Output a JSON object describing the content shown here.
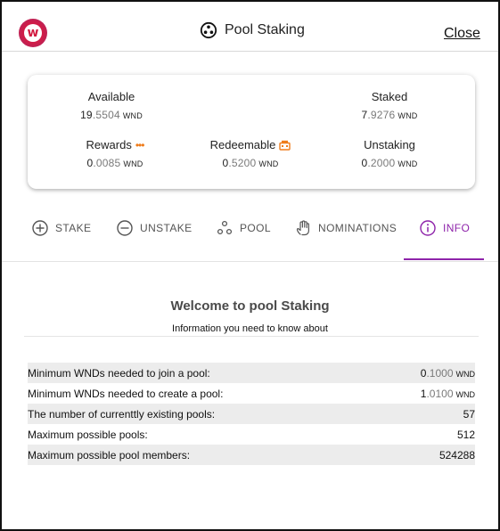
{
  "header": {
    "logo_letter": "w",
    "title": "Pool Staking",
    "close_label": "Close"
  },
  "balances": {
    "available": {
      "label": "Available",
      "int": "19",
      "dec": ".5504",
      "unit": "WND"
    },
    "staked": {
      "label": "Staked",
      "int": "7",
      "dec": ".9276",
      "unit": "WND"
    },
    "rewards": {
      "label": "Rewards",
      "int": "0",
      "dec": ".0085",
      "unit": "WND"
    },
    "redeemable": {
      "label": "Redeemable",
      "int": "0",
      "dec": ".5200",
      "unit": "WND"
    },
    "unstaking": {
      "label": "Unstaking",
      "int": "0",
      "dec": ".2000",
      "unit": "WND"
    }
  },
  "tabs": [
    {
      "label": "STAKE",
      "icon": "plus-circle-icon"
    },
    {
      "label": "UNSTAKE",
      "icon": "minus-circle-icon"
    },
    {
      "label": "POOL",
      "icon": "pool-icon"
    },
    {
      "label": "NOMINATIONS",
      "icon": "hand-icon"
    },
    {
      "label": "INFO",
      "icon": "info-icon",
      "active": true
    }
  ],
  "info": {
    "welcome": "Welcome to pool Staking",
    "subtitle": "Information you need to know about",
    "rows": [
      {
        "label": "Minimum WNDs needed to join a pool:",
        "int": "0",
        "dec": ".1000",
        "unit": "WND"
      },
      {
        "label": "Minimum WNDs needed to create a pool:",
        "int": "1",
        "dec": ".0100",
        "unit": "WND"
      },
      {
        "label": "The number of currenttly existing pools:",
        "value": "57"
      },
      {
        "label": "Maximum possible pools:",
        "value": "512"
      },
      {
        "label": "Maximum possible pool members:",
        "value": "524288"
      }
    ]
  },
  "colors": {
    "accent": "#8e24aa",
    "rewards_dots": "#ef7c1a",
    "redeemable_icon": "#ef7c1a",
    "logo": "#e8173b"
  }
}
